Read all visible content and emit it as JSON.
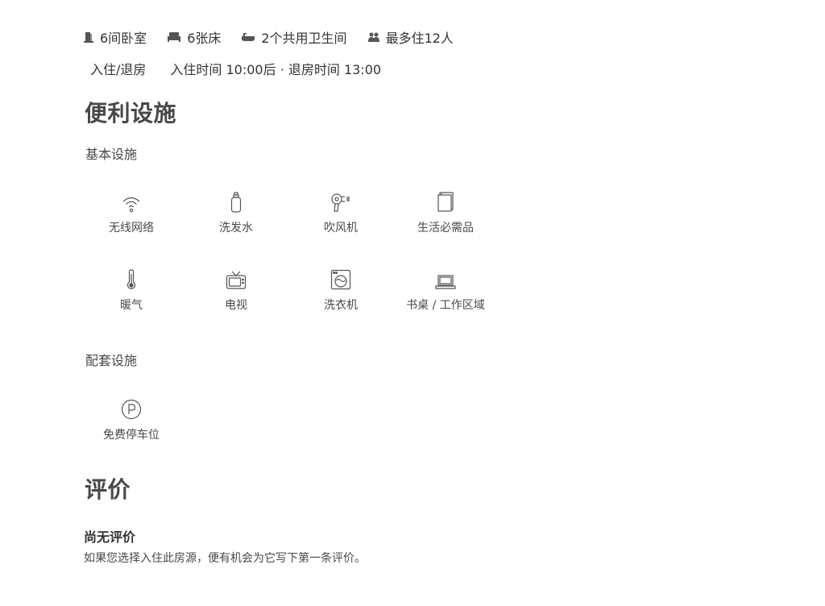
{
  "summary": {
    "bedrooms": "6间卧室",
    "beds": "6张床",
    "bathrooms": "2个共用卫生间",
    "guests": "最多住12人"
  },
  "checkin": {
    "label": "入住/退房",
    "value": "入住时间 10:00后 · 退房时间 13:00"
  },
  "amenities_section": {
    "title": "便利设施",
    "basic_title": "基本设施",
    "basic_items": [
      {
        "label": "无线网络",
        "icon": "wifi-icon"
      },
      {
        "label": "洗发水",
        "icon": "shampoo-icon"
      },
      {
        "label": "吹风机",
        "icon": "hair-dryer-icon"
      },
      {
        "label": "生活必需品",
        "icon": "essentials-icon"
      },
      {
        "label": "暖气",
        "icon": "thermometer-icon"
      },
      {
        "label": "电视",
        "icon": "tv-icon"
      },
      {
        "label": "洗衣机",
        "icon": "washer-icon"
      },
      {
        "label": "书桌 / 工作区域",
        "icon": "laptop-icon"
      }
    ],
    "facility_title": "配套设施",
    "facility_items": [
      {
        "label": "免费停车位",
        "icon": "parking-icon"
      }
    ]
  },
  "reviews": {
    "title": "评价",
    "empty_title": "尚无评价",
    "empty_text": "如果您选择入住此房源，便有机会为它写下第一条评价。"
  }
}
